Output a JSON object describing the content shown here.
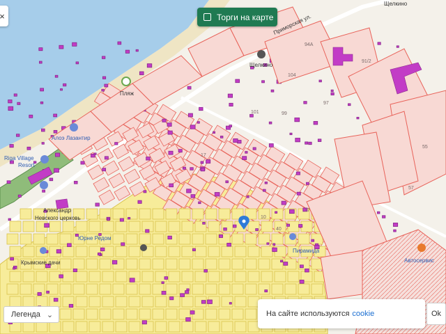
{
  "top_button": {
    "label": "Торги на карте"
  },
  "legend": {
    "label": "Легенда",
    "chevron": "chevron-down-icon"
  },
  "cookie": {
    "text": "На сайте используются",
    "link": "cookie",
    "ok": "Ok"
  },
  "close": {
    "icon": "close-icon",
    "glyph": "×"
  },
  "colors": {
    "water": "#a6cdea",
    "sand": "#efe5c4",
    "parcel_red": "#e8635a",
    "parcel_fill": "#f8d9d4",
    "parcel_yellow_fill": "#f7ec9a",
    "parcel_yellow_stroke": "#d9c24a",
    "park": "#8fbc7a",
    "building_purple": "#c23cc6",
    "accent_green": "#1f7a52",
    "marker_blue": "#2f7bd8"
  },
  "places": [
    {
      "name": "Пляж",
      "icon": "beach-icon"
    },
    {
      "name": "Алоэ Лазантир",
      "icon": "hotel-icon"
    },
    {
      "name": "Riga Village",
      "icon": "hotel-icon"
    },
    {
      "name": "Resort",
      "icon": ""
    },
    {
      "name": "Александр",
      "icon": "church-icon"
    },
    {
      "name": "Невского церковь",
      "icon": ""
    },
    {
      "name": "Юрне Редом",
      "icon": ""
    },
    {
      "name": "Крымские дачи",
      "icon": ""
    },
    {
      "name": "Щелкино",
      "icon": "bus-stop-icon"
    },
    {
      "name": "Щелкино",
      "icon": ""
    },
    {
      "name": "Приморская ул.",
      "icon": ""
    },
    {
      "name": "Пирамида",
      "icon": ""
    },
    {
      "name": "Автосервис",
      "icon": "car-service-icon"
    }
  ],
  "parcel_numbers": [
    "94А",
    "91/2",
    "104",
    "97",
    "99",
    "101",
    "10",
    "17",
    "40",
    "57",
    "55",
    "17"
  ]
}
